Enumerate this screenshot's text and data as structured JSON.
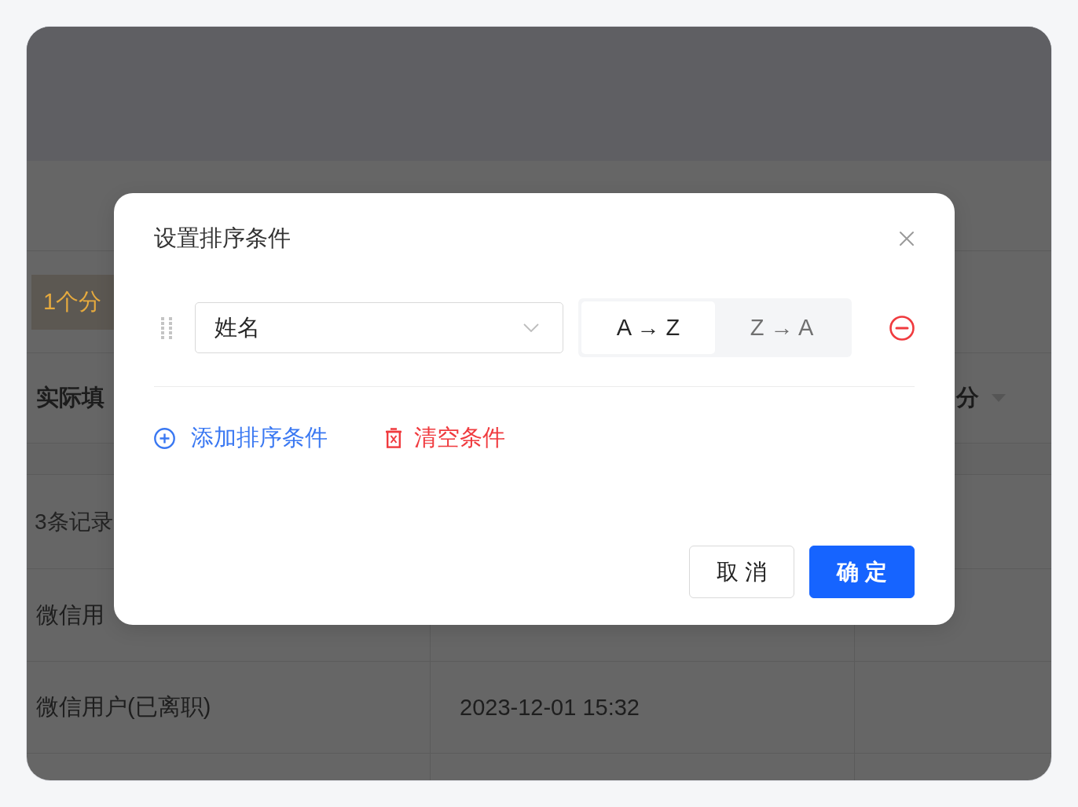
{
  "background": {
    "banner": {
      "text": "1个分"
    },
    "table_header": {
      "column_1": "实际填",
      "column_3": "分"
    },
    "record_count": "3条记录",
    "rows": [
      {
        "cells": [
          "微信用"
        ]
      },
      {
        "cells": [
          "微信用户(已离职)",
          "2023-12-01 15:32"
        ]
      }
    ]
  },
  "dialog": {
    "title": "设置排序条件",
    "sort_conditions": [
      {
        "field": "姓名",
        "directions": [
          {
            "label": "A → Z",
            "selected": true
          },
          {
            "label": "Z → A",
            "selected": false
          }
        ]
      }
    ],
    "actions": [
      {
        "kind": "add",
        "label": "添加排序条件"
      },
      {
        "kind": "clear",
        "label": "清空条件"
      }
    ],
    "buttons": [
      {
        "kind": "secondary",
        "label": "取 消"
      },
      {
        "kind": "primary",
        "label": "确 定"
      }
    ]
  }
}
